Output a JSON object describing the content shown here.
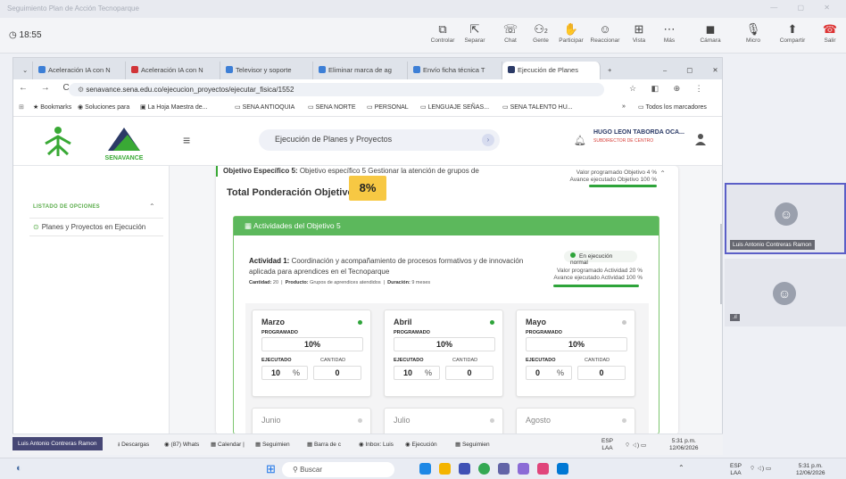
{
  "teams": {
    "window_title": "Seguimiento Plan de Acción Tecnoparque",
    "timer": "18:55",
    "controls": [
      {
        "label": "Controlar",
        "icon": "share-screen-icon"
      },
      {
        "label": "Separar",
        "icon": "popout-icon"
      },
      {
        "label": "Chat",
        "icon": "chat-icon"
      },
      {
        "label": "Gente",
        "icon": "people-icon",
        "count": "2"
      },
      {
        "label": "Participar",
        "icon": "hand-icon"
      },
      {
        "label": "Reaccionar",
        "icon": "emoji-icon"
      },
      {
        "label": "Vista",
        "icon": "grid-icon"
      },
      {
        "label": "Más",
        "icon": "more-icon"
      },
      {
        "label": "Cámara",
        "icon": "camera-off-icon"
      },
      {
        "label": "Micro",
        "icon": "mic-icon"
      },
      {
        "label": "Compartir",
        "icon": "share-icon"
      },
      {
        "label": "Salir",
        "icon": "leave-icon"
      }
    ],
    "participants": [
      {
        "name": "Luis Antonio Contreras Ramon"
      },
      {
        "name": "",
        "badge": ".ıl"
      }
    ]
  },
  "browser": {
    "tabs": [
      {
        "label": "Aceleración IA con N",
        "color": "#3d7fd6"
      },
      {
        "label": "Aceleración IA con N",
        "color": "#d13438"
      },
      {
        "label": "Televisor y soporte",
        "color": "#3d7fd6"
      },
      {
        "label": "Eliminar marca de ag",
        "color": "#3d7fd6"
      },
      {
        "label": "Envío ficha técnica T",
        "color": "#3d7fd6"
      },
      {
        "label": "Ejecución de Planes",
        "color": "#2b3a66"
      }
    ],
    "url": "senavance.sena.edu.co/ejecucion_proyectos/ejecutar_fisica/1552",
    "bookmarks": [
      "Bookmarks",
      "Soluciones para",
      "La Hoja Maestra de...",
      "SENA ANTIOQUIA",
      "SENA NORTE",
      "PERSONAL",
      "LENGUAJE SEÑAS...",
      "SENA TALENTO HU..."
    ],
    "bookmarks_more": "»",
    "all_bookmarks": "Todos los marcadores"
  },
  "app": {
    "logo_text": "SENAVANCE",
    "logo_sena": "SENA",
    "page_title": "Ejecución de Planes y Proyectos",
    "user_name": "HUGO LEON TABORDA OCA...",
    "user_role": "SUBDIRECTOR DE CENTRO",
    "sidebar": {
      "heading": "LISTADO DE OPCIONES",
      "items": [
        "Planes y Proyectos en Ejecución"
      ]
    },
    "objective": {
      "label": "Objetivo Específico 5:",
      "text": "Objetivo específico 5 Gestionar la atención de grupos de",
      "programado": "Valor programado Objetivo 4 %",
      "ejecutado": "Avance ejecutado Objetivo 100 %",
      "progress": 1.0
    },
    "total_label": "Total Ponderación Objetivos:",
    "total_value": "8%",
    "activities_header": "Actividades del Objetivo 5",
    "activity": {
      "label": "Actividad 1:",
      "text": "Coordinación y acompañamiento de procesos formativos y de innovación aplicada para aprendices en el Tecnoparque",
      "cantidad_label": "Cantidad:",
      "cantidad": "20",
      "producto_label": "Producto:",
      "producto": "Grupos de aprendices atendidos",
      "duracion_label": "Duración:",
      "duracion": "9 meses",
      "status": "En ejecución normal",
      "programado": "Valor programado Actividad 20 %",
      "ejecutado": "Avance ejecutado Actividad 100 %",
      "progress": 1.0
    },
    "months": [
      {
        "name": "Marzo",
        "dot": "#2ea43a",
        "programado_label": "PROGRAMADO",
        "programado": "10%",
        "ejecutado_label": "EJECUTADO",
        "cantidad_label": "CANTIDAD",
        "ejecutado": "10",
        "pct": "%",
        "cantidad": "0"
      },
      {
        "name": "Abril",
        "dot": "#2ea43a",
        "programado_label": "PROGRAMADO",
        "programado": "10%",
        "ejecutado_label": "EJECUTADO",
        "cantidad_label": "CANTIDAD",
        "ejecutado": "10",
        "pct": "%",
        "cantidad": "0"
      },
      {
        "name": "Mayo",
        "dot": "#c8c8c8",
        "programado_label": "PROGRAMADO",
        "programado": "10%",
        "ejecutado_label": "EJECUTADO",
        "cantidad_label": "CANTIDAD",
        "ejecutado": "0",
        "pct": "%",
        "cantidad": "0"
      },
      {
        "name": "Junio",
        "dot": "#d0d0d0"
      },
      {
        "name": "Julio",
        "dot": "#d0d0d0"
      },
      {
        "name": "Agosto",
        "dot": "#d0d0d0"
      }
    ]
  },
  "inner_taskbar": {
    "user": "Luis Antonio Contreras Ramon",
    "items": [
      "Descargas",
      "(87) Whats",
      "Calendar |",
      "Seguimien",
      "Barra de c",
      "Inbox: Luis",
      "Ejecución",
      "Seguimien"
    ],
    "lang": "ESP",
    "lang2": "LAA",
    "time": "5:31 p.m.",
    "date": "12/06/2026"
  },
  "taskbar": {
    "search": "Buscar",
    "lang": "ESP",
    "lang2": "LAA",
    "time": "5:31 p.m.",
    "date": "12/06/2026"
  }
}
